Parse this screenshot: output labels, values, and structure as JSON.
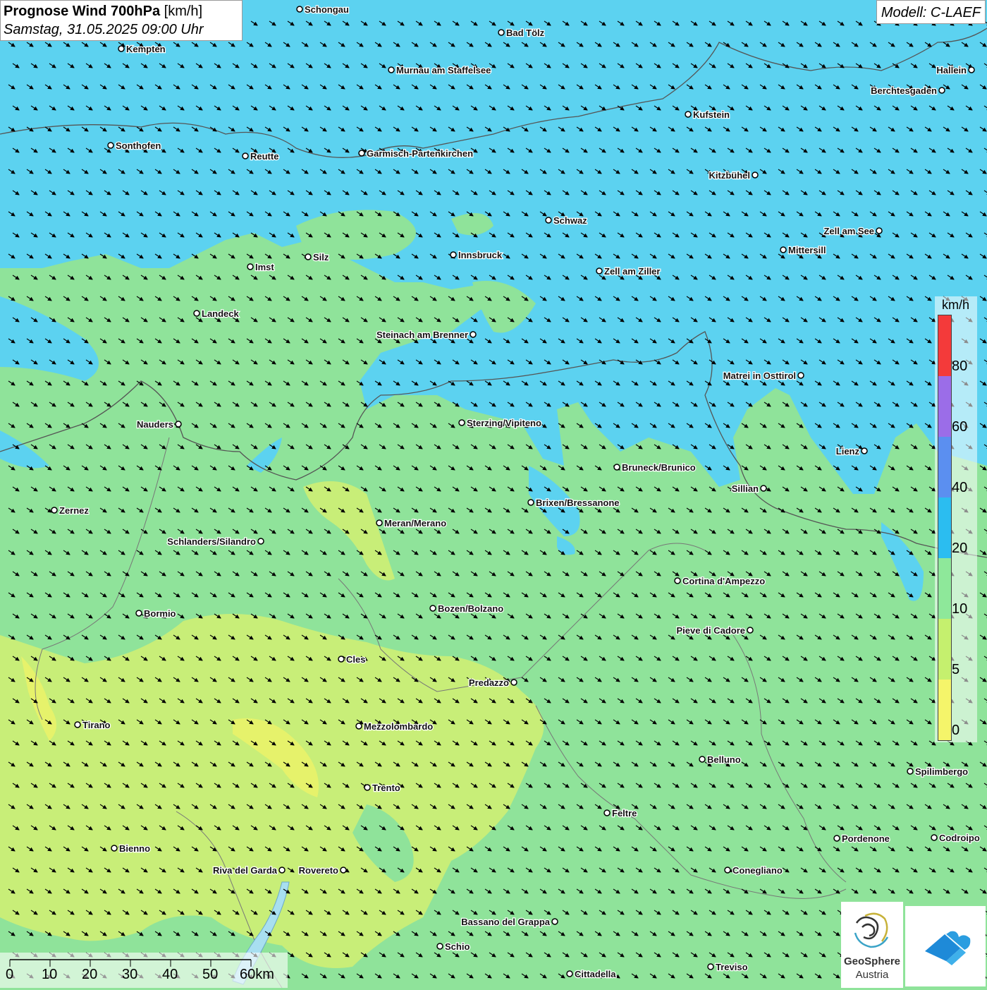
{
  "header": {
    "title_bold": "Prognose Wind 700hPa",
    "title_unit": "[km/h]",
    "datetime": "Samstag, 31.05.2025 09:00 Uhr"
  },
  "model_label": "Modell: C-LAEF",
  "legend": {
    "unit": "km/h",
    "ticks": [
      "80",
      "60",
      "40",
      "20",
      "10",
      "5",
      "0"
    ],
    "colors": [
      "#f43a3a",
      "#9b6de8",
      "#5b8ff0",
      "#2bbdf0",
      "#8ee89a",
      "#c5f06e",
      "#f5f56a"
    ]
  },
  "scalebar": {
    "labels": [
      "0",
      "10",
      "20",
      "30",
      "40",
      "50",
      "60km"
    ]
  },
  "logos": {
    "geosphere_line1": "GeoSphere",
    "geosphere_line2": "Austria"
  },
  "cities": [
    "Schongau",
    "Bad Tölz",
    "Kempten",
    "Murnau am Staffelsee",
    "Hallein",
    "Berchtesgaden",
    "Kufstein",
    "Sonthofen",
    "Reutte",
    "Garmisch-Partenkirchen",
    "Kitzbühel",
    "Schwaz",
    "Zell am See",
    "Innsbruck",
    "Mittersill",
    "Silz",
    "Imst",
    "Zell am Ziller",
    "Landeck",
    "Steinach am Brenner",
    "Matrei in Osttirol",
    "Nauders",
    "Sterzing/Vipiteno",
    "Lienz",
    "Bruneck/Brunico",
    "Sillian",
    "Brixen/Bressanone",
    "Zernez",
    "Meran/Merano",
    "Schlanders/Silandro",
    "Cortina d'Ampezzo",
    "Bozen/Bolzano",
    "Bormio",
    "Pieve di Cadore",
    "Cles",
    "Predazzo",
    "Tirano",
    "Mezzolombardo",
    "Belluno",
    "Spilimbergo",
    "Trento",
    "Feltre",
    "Pordenone",
    "Codroipo",
    "Bienno",
    "Riva del Garda",
    "Rovereto",
    "Conegliano",
    "Bassano del Grappa",
    "Schio",
    "Treviso",
    "Cittadella"
  ],
  "wind_arrow_direction": "south-east"
}
